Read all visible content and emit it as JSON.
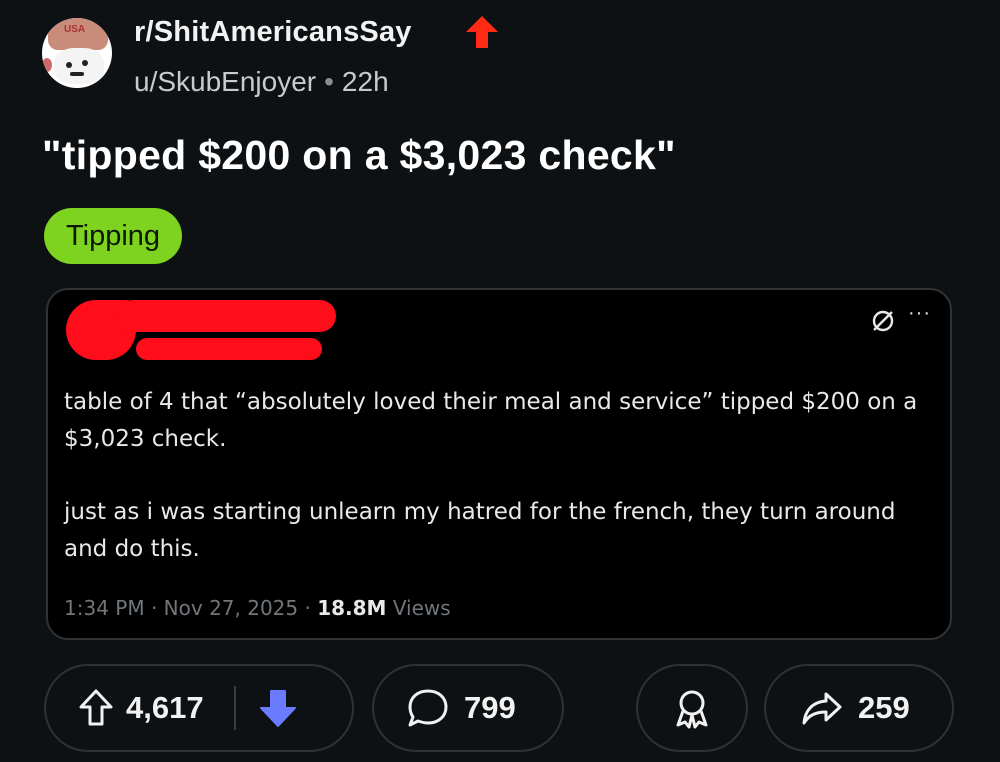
{
  "post": {
    "subreddit": "r/ShitAmericansSay",
    "author": "u/SkubEnjoyer",
    "separator": "•",
    "age": "22h",
    "title": "\"tipped $200 on a $3,023 check\"",
    "flair": "Tipping",
    "flair_color": "#7ed321"
  },
  "embed": {
    "more_label": "···",
    "paragraph1": "table of 4 that “absolutely loved their meal and service” tipped $200 on a $3,023 check.",
    "paragraph2": "just as i was starting unlearn my hatred for the french, they turn around and do this.",
    "time": "1:34 PM",
    "dot": "·",
    "date": "Nov 27, 2025",
    "views_count": "18.8M",
    "views_label": "Views",
    "redaction_color": "#ff0d1a"
  },
  "actions": {
    "upvotes": "4,617",
    "comments": "799",
    "shares": "259",
    "downvote_color": "#6b7bff"
  },
  "icons": {
    "award": "red-up-arrow-icon",
    "upvote": "upvote-arrow-icon",
    "downvote": "downvote-arrow-icon",
    "comment": "comment-bubble-icon",
    "award_action": "award-icon",
    "share": "share-arrow-icon",
    "grok": "grok-icon"
  }
}
